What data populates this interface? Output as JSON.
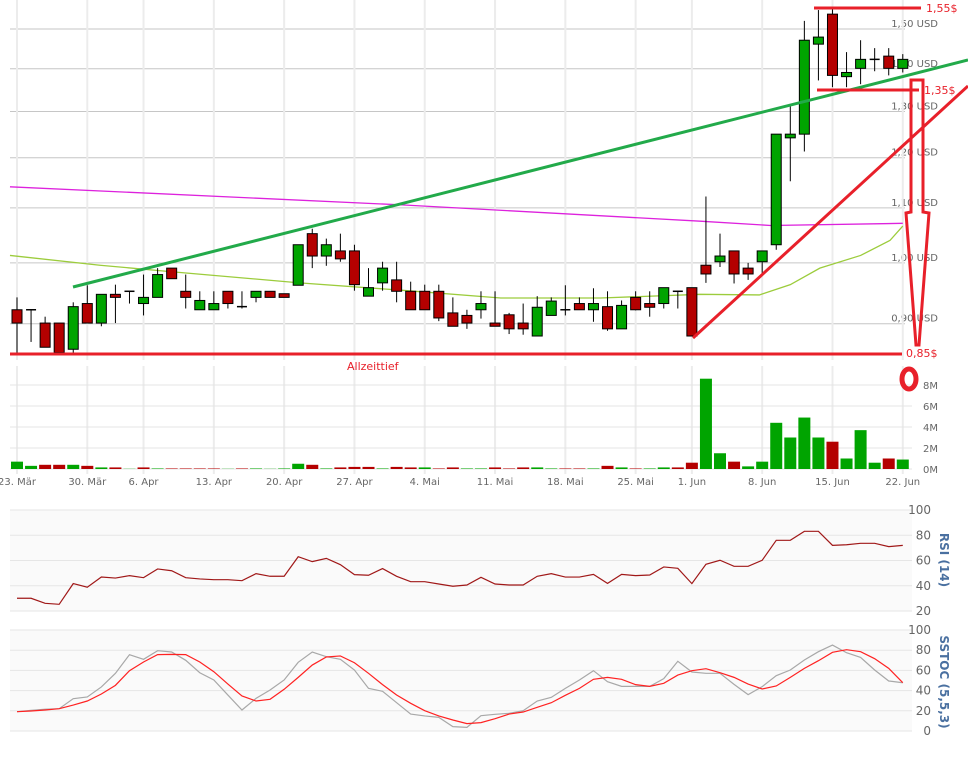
{
  "colors": {
    "up": "#00a400",
    "down": "#b40000",
    "annotation": "#e8202a",
    "trendline": "#22aa4a",
    "ma_short": "#9ccc3c",
    "ma_long": "#dd22dd",
    "rsi": "#a01818",
    "stoch_k": "#a8a8a8",
    "stoch_d": "#ff2222",
    "indicator_title": "#4a70a0"
  },
  "chart_data": [
    {
      "type": "candlestick",
      "y_scale": "log",
      "y_unit": "USD",
      "y_tick_values": [
        0.9,
        1.0,
        1.1,
        1.2,
        1.3,
        1.4,
        1.5
      ],
      "y_tick_labels": [
        "0,90 USD",
        "1,00 USD",
        "1,10 USD",
        "1,20 USD",
        "1,30 USD",
        "1,40 USD",
        "1,50 USD"
      ],
      "x_tick_labels": [
        "23. Mär",
        "30. Mär",
        "6. Apr",
        "13. Apr",
        "20. Apr",
        "27. Apr",
        "4. Mai",
        "11. Mai",
        "18. Mai",
        "25. Mai",
        "1. Jun",
        "8. Jun",
        "15. Jun",
        "22. Jun"
      ],
      "x_tick_candle_index": [
        1,
        6,
        10,
        15,
        20,
        25,
        30,
        35,
        40,
        45,
        49,
        54,
        59,
        64
      ],
      "grid": true,
      "candles_ohlc": [
        [
          0.922,
          0.942,
          0.855,
          0.901
        ],
        [
          0.922,
          0.922,
          0.872,
          0.922
        ],
        [
          0.901,
          0.911,
          0.864,
          0.864
        ],
        [
          0.901,
          0.901,
          0.855,
          0.856
        ],
        [
          0.861,
          0.934,
          0.855,
          0.927
        ],
        [
          0.932,
          0.962,
          0.901,
          0.901
        ],
        [
          0.901,
          0.947,
          0.896,
          0.947
        ],
        [
          0.947,
          0.963,
          0.901,
          0.942
        ],
        [
          0.952,
          0.952,
          0.932,
          0.952
        ],
        [
          0.932,
          0.98,
          0.913,
          0.942
        ],
        [
          0.942,
          0.991,
          0.942,
          0.98
        ],
        [
          0.991,
          0.991,
          0.973,
          0.973
        ],
        [
          0.952,
          0.98,
          0.924,
          0.942
        ],
        [
          0.922,
          0.952,
          0.922,
          0.937
        ],
        [
          0.922,
          0.952,
          0.922,
          0.932
        ],
        [
          0.952,
          0.952,
          0.924,
          0.932
        ],
        [
          0.927,
          0.952,
          0.924,
          0.927
        ],
        [
          0.942,
          0.952,
          0.934,
          0.952
        ],
        [
          0.952,
          0.952,
          0.942,
          0.942
        ],
        [
          0.948,
          0.948,
          0.942,
          0.942
        ],
        [
          0.962,
          1.032,
          0.962,
          1.032
        ],
        [
          1.052,
          1.061,
          0.991,
          1.012
        ],
        [
          1.012,
          1.043,
          0.995,
          1.032
        ],
        [
          1.021,
          1.052,
          1.002,
          1.007
        ],
        [
          1.021,
          1.032,
          0.953,
          0.963
        ],
        [
          0.944,
          0.991,
          0.944,
          0.958
        ],
        [
          0.966,
          1.002,
          0.953,
          0.991
        ],
        [
          0.971,
          1.002,
          0.934,
          0.952
        ],
        [
          0.952,
          0.968,
          0.922,
          0.922
        ],
        [
          0.952,
          0.963,
          0.922,
          0.922
        ],
        [
          0.952,
          0.963,
          0.904,
          0.909
        ],
        [
          0.917,
          0.942,
          0.896,
          0.896
        ],
        [
          0.913,
          0.922,
          0.892,
          0.901
        ],
        [
          0.922,
          0.952,
          0.908,
          0.932
        ],
        [
          0.901,
          0.952,
          0.896,
          0.896
        ],
        [
          0.914,
          0.917,
          0.884,
          0.892
        ],
        [
          0.901,
          0.932,
          0.883,
          0.892
        ],
        [
          0.881,
          0.944,
          0.881,
          0.926
        ],
        [
          0.913,
          0.942,
          0.913,
          0.936
        ],
        [
          0.922,
          0.962,
          0.913,
          0.922
        ],
        [
          0.932,
          0.942,
          0.922,
          0.922
        ],
        [
          0.922,
          0.957,
          0.903,
          0.932
        ],
        [
          0.927,
          0.952,
          0.889,
          0.892
        ],
        [
          0.892,
          0.937,
          0.892,
          0.929
        ],
        [
          0.942,
          0.952,
          0.921,
          0.922
        ],
        [
          0.932,
          0.952,
          0.911,
          0.926
        ],
        [
          0.932,
          0.958,
          0.924,
          0.958
        ],
        [
          0.952,
          0.953,
          0.924,
          0.952
        ],
        [
          0.958,
          0.958,
          0.881,
          0.881
        ],
        [
          0.996,
          1.122,
          0.966,
          0.981
        ],
        [
          1.002,
          1.052,
          0.993,
          1.012
        ],
        [
          1.021,
          1.021,
          0.965,
          0.981
        ],
        [
          0.991,
          1.0,
          0.971,
          0.981
        ],
        [
          1.002,
          1.021,
          0.983,
          1.021
        ],
        [
          1.032,
          1.25,
          1.023,
          1.25
        ],
        [
          1.242,
          1.313,
          1.152,
          1.25
        ],
        [
          1.25,
          1.521,
          1.213,
          1.471
        ],
        [
          1.461,
          1.55,
          1.372,
          1.479
        ],
        [
          1.539,
          1.553,
          1.356,
          1.384
        ],
        [
          1.381,
          1.441,
          1.356,
          1.391
        ],
        [
          1.401,
          1.471,
          1.363,
          1.423
        ],
        [
          1.423,
          1.451,
          1.394,
          1.423
        ],
        [
          1.431,
          1.451,
          1.384,
          1.401
        ],
        [
          1.401,
          1.436,
          1.391,
          1.423
        ]
      ],
      "moving_averages": [
        {
          "color_key": "ma_short",
          "points_index_price": [
            [
              0.5,
              1.013
            ],
            [
              6.9,
              0.996
            ],
            [
              11.9,
              0.985
            ],
            [
              21.1,
              0.966
            ],
            [
              28.2,
              0.954
            ],
            [
              35.4,
              0.941
            ],
            [
              42.5,
              0.941
            ],
            [
              49.6,
              0.947
            ],
            [
              53.8,
              0.946
            ],
            [
              56.0,
              0.963
            ],
            [
              58.1,
              0.991
            ],
            [
              61.0,
              1.013
            ],
            [
              63.1,
              1.04
            ],
            [
              64.0,
              1.066
            ]
          ]
        },
        {
          "color_key": "ma_long",
          "points_index_price": [
            [
              0.5,
              1.141
            ],
            [
              28.2,
              1.106
            ],
            [
              49.6,
              1.075
            ],
            [
              54.6,
              1.067
            ],
            [
              64.0,
              1.071
            ]
          ]
        }
      ]
    },
    {
      "type": "bar",
      "y_unit": "M",
      "y_tick_labels": [
        "0M",
        "2M",
        "4M",
        "6M",
        "8M"
      ],
      "y_tick_values": [
        0,
        2,
        4,
        6,
        8
      ],
      "volume_millions": [
        0.7,
        0.3,
        0.4,
        0.4,
        0.4,
        0.3,
        0.15,
        0.15,
        0.02,
        0.15,
        0.05,
        0.05,
        0.05,
        0.05,
        0.05,
        0.02,
        0.05,
        0.05,
        0.02,
        0.05,
        0.5,
        0.4,
        0.05,
        0.15,
        0.2,
        0.2,
        0.05,
        0.2,
        0.15,
        0.15,
        0.05,
        0.15,
        0.05,
        0.05,
        0.15,
        0.05,
        0.15,
        0.15,
        0.05,
        0.05,
        0.05,
        0.05,
        0.3,
        0.15,
        0.05,
        0.05,
        0.15,
        0.15,
        0.6,
        8.6,
        1.5,
        0.7,
        0.25,
        0.7,
        4.4,
        3.0,
        4.9,
        3.0,
        2.6,
        1.0,
        3.7,
        0.6,
        1.0,
        0.9
      ],
      "volume_up": [
        1,
        1,
        0,
        0,
        1,
        0,
        1,
        0,
        1,
        0,
        1,
        0,
        0,
        0,
        0,
        1,
        0,
        1,
        1,
        1,
        1,
        0,
        1,
        0,
        0,
        0,
        1,
        0,
        0,
        1,
        0,
        0,
        1,
        1,
        0,
        0,
        0,
        1,
        1,
        0,
        0,
        1,
        0,
        1,
        0,
        1,
        1,
        0,
        0,
        1,
        1,
        0,
        1,
        1,
        1,
        1,
        1,
        1,
        0,
        1,
        1,
        1,
        0,
        1
      ]
    },
    {
      "type": "line",
      "title": "RSI (14)",
      "y_tick_labels": [
        "20",
        "40",
        "60",
        "80",
        "100"
      ],
      "y_tick_values": [
        20,
        40,
        60,
        80,
        100
      ],
      "values": [
        30.1,
        30.1,
        26.1,
        25.3,
        41.7,
        38.8,
        46.9,
        46.1,
        48.0,
        46.4,
        53.3,
        51.9,
        46.4,
        45.4,
        44.8,
        44.8,
        44.0,
        49.6,
        47.5,
        47.5,
        63.0,
        59.1,
        61.7,
        56.7,
        48.8,
        48.3,
        53.6,
        47.5,
        43.2,
        43.2,
        41.4,
        39.6,
        40.6,
        46.7,
        41.4,
        40.6,
        40.6,
        47.5,
        49.6,
        46.9,
        46.9,
        49.0,
        41.9,
        49.0,
        48.0,
        48.5,
        54.9,
        53.8,
        41.7,
        57.0,
        60.2,
        55.4,
        55.4,
        60.2,
        76.0,
        76.0,
        83.1,
        83.1,
        72.0,
        72.5,
        73.6,
        73.6,
        71.0,
        72.0
      ]
    },
    {
      "type": "line",
      "title": "SSTOC (5,5,3)",
      "y_tick_labels": [
        "0",
        "20",
        "40",
        "60",
        "80",
        "100"
      ],
      "y_tick_values": [
        0,
        20,
        40,
        60,
        80,
        100
      ],
      "series_k": [
        19.1,
        20.5,
        21.5,
        22.1,
        32.0,
        33.7,
        43.6,
        57.1,
        75.6,
        71.0,
        79.5,
        78.2,
        70.0,
        57.7,
        50.5,
        35.6,
        20.8,
        32.3,
        40.6,
        50.5,
        68.0,
        78.2,
        73.6,
        71.0,
        60.4,
        42.2,
        39.3,
        28.0,
        16.8,
        14.9,
        13.5,
        4.3,
        3.6,
        15.2,
        16.5,
        17.5,
        20.1,
        29.7,
        33.3,
        42.2,
        50.5,
        59.7,
        48.8,
        44.2,
        44.2,
        44.2,
        51.8,
        69.0,
        58.4,
        57.1,
        57.1,
        46.2,
        36.0,
        43.9,
        54.8,
        60.4,
        70.3,
        78.5,
        85.1,
        77.5,
        72.9,
        60.4,
        49.5,
        47.8
      ],
      "series_d": [
        19.1,
        19.8,
        20.8,
        22.1,
        25.7,
        29.7,
        36.6,
        45.2,
        59.7,
        68.3,
        75.6,
        75.9,
        75.6,
        68.3,
        58.7,
        46.5,
        34.7,
        29.7,
        31.4,
        41.3,
        53.1,
        65.3,
        73.3,
        74.3,
        67.6,
        57.1,
        45.9,
        35.6,
        27.4,
        20.1,
        14.9,
        10.9,
        7.3,
        8.3,
        12.2,
        16.8,
        18.8,
        23.4,
        28.0,
        35.3,
        42.2,
        51.2,
        53.1,
        51.2,
        45.9,
        44.2,
        47.2,
        55.4,
        59.7,
        61.7,
        57.7,
        53.1,
        46.5,
        41.6,
        44.6,
        53.1,
        62.0,
        69.6,
        77.9,
        80.5,
        78.5,
        71.6,
        62.0,
        47.8
      ]
    }
  ],
  "annotations": {
    "high_label": "1,55$",
    "support_label": "1,35$",
    "low_label": "0,85$",
    "all_time_low_label": "Allzeittief"
  }
}
